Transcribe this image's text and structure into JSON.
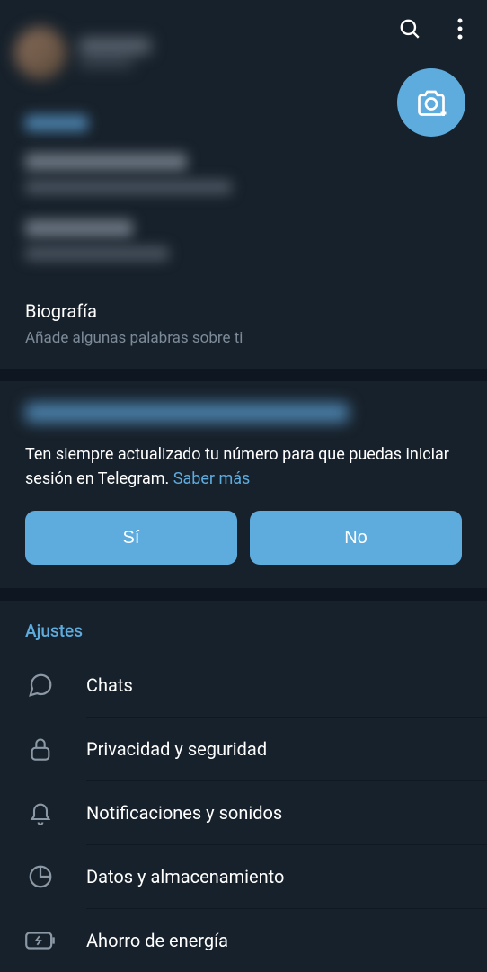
{
  "bio": {
    "title": "Biografía",
    "subtitle": "Añade algunas palabras sobre ti"
  },
  "prompt": {
    "text": "Ten siempre actualizado tu número para que puedas iniciar sesión en Telegram. ",
    "link": "Saber más",
    "yes": "Sí",
    "no": "No"
  },
  "settings": {
    "title": "Ajustes",
    "items": [
      {
        "label": "Chats"
      },
      {
        "label": "Privacidad y seguridad"
      },
      {
        "label": "Notificaciones y sonidos"
      },
      {
        "label": "Datos y almacenamiento"
      },
      {
        "label": "Ahorro de energía"
      }
    ]
  }
}
